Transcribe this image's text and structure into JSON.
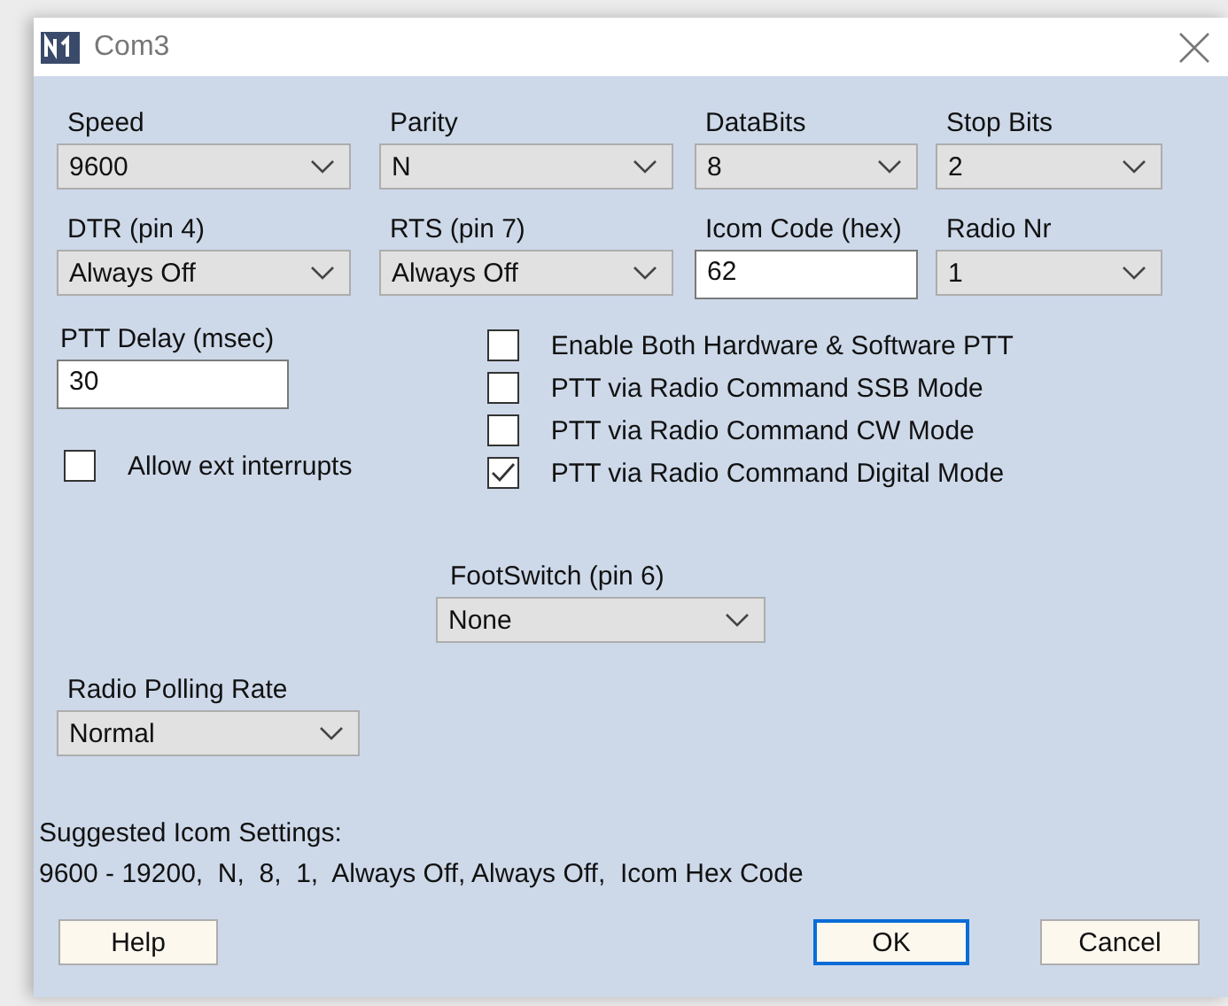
{
  "window": {
    "title": "Com3"
  },
  "rows": [
    [
      {
        "kind": "combo",
        "label": "Speed",
        "value": "9600"
      },
      {
        "kind": "combo",
        "label": "Parity",
        "value": "N"
      },
      {
        "kind": "combo",
        "label": "DataBits",
        "value": "8"
      },
      {
        "kind": "combo",
        "label": "Stop Bits",
        "value": "2"
      }
    ],
    [
      {
        "kind": "combo",
        "label": "DTR (pin 4)",
        "value": "Always Off"
      },
      {
        "kind": "combo",
        "label": "RTS (pin 7)",
        "value": "Always Off"
      },
      {
        "kind": "text",
        "label": "Icom Code (hex)",
        "value": "62"
      },
      {
        "kind": "combo",
        "label": "Radio Nr",
        "value": "1"
      }
    ]
  ],
  "ptt_delay": {
    "label": "PTT Delay  (msec)",
    "value": "30"
  },
  "allow_ext_interrupts": {
    "label": "Allow ext interrupts",
    "checked": false
  },
  "ptt_options": [
    {
      "label": "Enable Both Hardware & Software PTT",
      "checked": false
    },
    {
      "label": "PTT via Radio Command SSB Mode",
      "checked": false
    },
    {
      "label": "PTT via Radio Command CW Mode",
      "checked": false
    },
    {
      "label": "PTT via Radio Command Digital Mode",
      "checked": true
    }
  ],
  "footswitch": {
    "label": "FootSwitch (pin 6)",
    "value": "None"
  },
  "polling_rate": {
    "label": "Radio Polling Rate",
    "value": "Normal"
  },
  "suggested": [
    "Suggested Icom Settings:",
    "9600 - 19200,  N,  8,  1,  Always Off, Always Off,  Icom Hex Code"
  ],
  "buttons": [
    {
      "label": "Help",
      "default": false
    },
    {
      "label": "OK",
      "default": true
    },
    {
      "label": "Cancel",
      "default": false
    }
  ]
}
